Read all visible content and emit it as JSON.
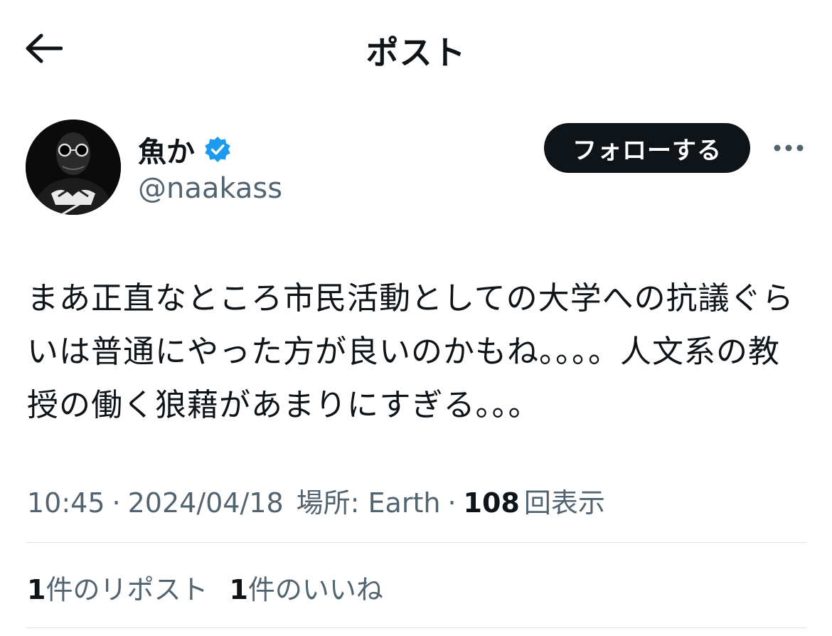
{
  "header": {
    "title": "ポスト"
  },
  "author": {
    "display_name": "魚か",
    "handle": "@naakass",
    "verified_color": "#1d9bf0"
  },
  "actions": {
    "follow_label": "フォローする"
  },
  "post": {
    "text": "まあ正直なところ市民活動としての大学への抗議ぐらいは普通にやった方が良いのかもね。。。。人文系の教授の働く狼藉があまりにすぎる。。。"
  },
  "meta": {
    "time": "10:45",
    "date": "2024/04/18",
    "location_label": "場所: Earth",
    "views_count": "108",
    "views_label": "回表示",
    "separator": "·"
  },
  "stats": {
    "reposts_count": "1",
    "reposts_label": "件のリポスト",
    "likes_count": "1",
    "likes_label": "件のいいね"
  },
  "colors": {
    "text": "#0f1419",
    "secondary": "#536471",
    "button_bg": "#0f1419",
    "divider": "#dfe3e6"
  },
  "icons": [
    "back-arrow-icon",
    "verified-badge-icon",
    "more-options-icon"
  ]
}
